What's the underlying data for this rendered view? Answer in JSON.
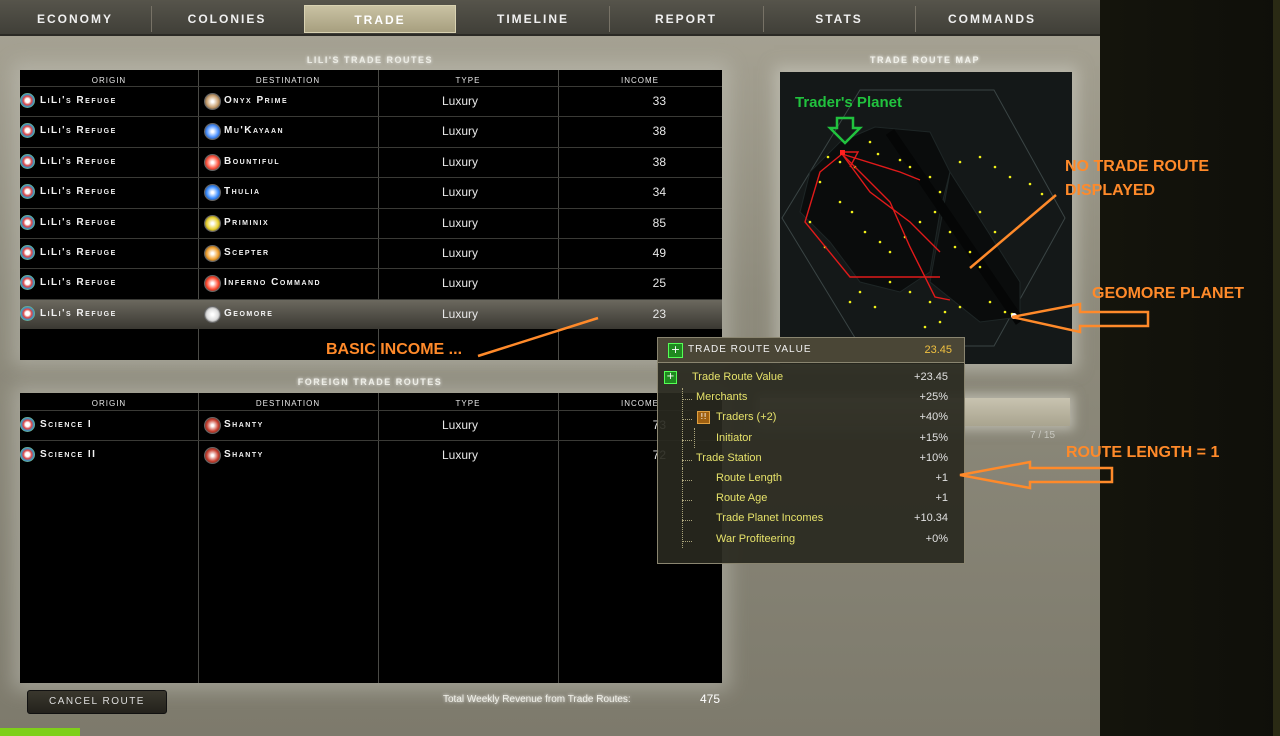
{
  "tabs": [
    "Economy",
    "Colonies",
    "Trade",
    "Timeline",
    "Report",
    "Stats",
    "Commands"
  ],
  "active_tab": "Trade",
  "own_routes": {
    "title": "Lili's Trade Routes",
    "headers": [
      "Origin",
      "Destination",
      "Type",
      "Income"
    ],
    "rows": [
      {
        "origin": "LiLi's Refuge",
        "destination": "Onyx Prime",
        "type": "Luxury",
        "income": "33",
        "dest_icon": "onyx-planet-icon",
        "color": "#c8a070"
      },
      {
        "origin": "LiLi's Refuge",
        "destination": "Mu'Kayaan",
        "type": "Luxury",
        "income": "38",
        "dest_icon": "mukayaan-emblem-icon",
        "color": "#4a90ff"
      },
      {
        "origin": "LiLi's Refuge",
        "destination": "Bountiful",
        "type": "Luxury",
        "income": "38",
        "dest_icon": "bountiful-emblem-icon",
        "color": "#ff5540"
      },
      {
        "origin": "LiLi's Refuge",
        "destination": "Thulia",
        "type": "Luxury",
        "income": "34",
        "dest_icon": "thulia-emblem-icon",
        "color": "#3a8cff"
      },
      {
        "origin": "LiLi's Refuge",
        "destination": "Priminix",
        "type": "Luxury",
        "income": "85",
        "dest_icon": "priminix-emblem-icon",
        "color": "#e8d030"
      },
      {
        "origin": "LiLi's Refuge",
        "destination": "Scepter",
        "type": "Luxury",
        "income": "49",
        "dest_icon": "scepter-emblem-icon",
        "color": "#f0a030"
      },
      {
        "origin": "LiLi's Refuge",
        "destination": "Inferno Command",
        "type": "Luxury",
        "income": "25",
        "dest_icon": "inferno-emblem-icon",
        "color": "#ff4a30"
      },
      {
        "origin": "LiLi's Refuge",
        "destination": "Geomore",
        "type": "Luxury",
        "income": "23",
        "dest_icon": "geomore-emblem-icon",
        "color": "#dddddd"
      }
    ]
  },
  "foreign_routes": {
    "title": "Foreign Trade Routes",
    "headers": [
      "Origin",
      "Destination",
      "Type",
      "Income"
    ],
    "rows": [
      {
        "origin": "Science I",
        "destination": "Shanty",
        "type": "Luxury",
        "income": "73",
        "dest_icon": "shanty-emblem-icon",
        "color": "#c84030"
      },
      {
        "origin": "Science II",
        "destination": "Shanty",
        "type": "Luxury",
        "income": "72",
        "dest_icon": "shanty-emblem-icon",
        "color": "#c84030"
      }
    ]
  },
  "map": {
    "title": "Trade Route Map"
  },
  "tooltip": {
    "title": "Trade Route Value",
    "title_value": "23.45",
    "lines": [
      {
        "label": "Trade Route Value",
        "value": "+23.45"
      },
      {
        "label": "Merchants",
        "value": "+25%"
      },
      {
        "label": "Traders (+2)",
        "value": "+40%"
      },
      {
        "label": "Initiator",
        "value": "+15%"
      },
      {
        "label": "Trade Station",
        "value": "+10%"
      },
      {
        "label": "Route Length",
        "value": "+1"
      },
      {
        "label": "Route Age",
        "value": "+1"
      },
      {
        "label": "Trade Planet Incomes",
        "value": "+10.34"
      },
      {
        "label": "War Profiteering",
        "value": "+0%"
      }
    ]
  },
  "sidebar": {
    "count": "7 / 15"
  },
  "footer": {
    "cancel_label": "Cancel Route",
    "total_label": "Total Weekly Revenue from Trade Routes:",
    "total_value": "475"
  },
  "annotations": {
    "traders_planet": "Trader's Planet",
    "no_trade_route_line1": "NO TRADE ROUTE",
    "no_trade_route_line2": "DISPLAYED",
    "geomore_planet": "GEOMORE PLANET",
    "basic_income": "BASIC INCOME ...",
    "route_length": "ROUTE LENGTH = 1"
  },
  "colors": {
    "annotation_orange": "#ff8a2a",
    "annotation_green": "#21c23e",
    "route_red": "#e01a1a",
    "star_yellow": "#f2f21a"
  }
}
